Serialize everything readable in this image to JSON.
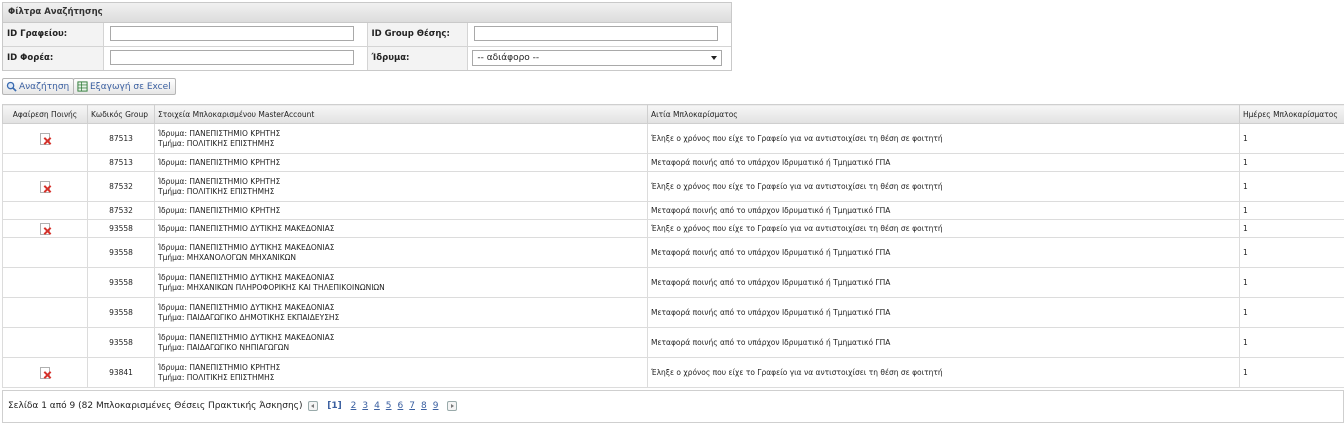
{
  "filter": {
    "title": "Φίλτρα Αναζήτησης",
    "office_id_label": "ID Γραφείου:",
    "office_id_value": "",
    "group_id_label": "ID Group Θέσης:",
    "group_id_value": "",
    "provider_id_label": "ID Φορέα:",
    "provider_id_value": "",
    "institution_label": "Ίδρυμα:",
    "institution_value": "-- αδιάφορο --"
  },
  "toolbar": {
    "search_label": "Αναζήτηση",
    "export_label": "Εξαγωγή σε Excel"
  },
  "grid": {
    "columns": [
      "Αφαίρεση Ποινής",
      "Κωδικός Group",
      "Στοιχεία Μπλοκαρισμένου MasterAccount",
      "Αιτία Μπλοκαρίσματος",
      "Ημέρες Μπλοκαρίσματος"
    ],
    "rows": [
      {
        "remove": true,
        "group": "87513",
        "line1": "Ίδρυμα: ΠΑΝΕΠΙΣΤΗΜΙΟ ΚΡΗΤΗΣ",
        "line2": "Τμήμα: ΠΟΛΙΤΙΚΗΣ ΕΠΙΣΤΗΜΗΣ",
        "reason": "Έληξε ο χρόνος που είχε το Γραφείο για να αντιστοιχίσει τη θέση σε φοιτητή",
        "days": "1"
      },
      {
        "remove": false,
        "group": "87513",
        "line1": "Ίδρυμα: ΠΑΝΕΠΙΣΤΗΜΙΟ ΚΡΗΤΗΣ",
        "line2": "",
        "reason": "Μεταφορά ποινής από το υπάρχον Ιδρυματικό ή Τμηματικό ΓΠΑ",
        "days": "1"
      },
      {
        "remove": true,
        "group": "87532",
        "line1": "Ίδρυμα: ΠΑΝΕΠΙΣΤΗΜΙΟ ΚΡΗΤΗΣ",
        "line2": "Τμήμα: ΠΟΛΙΤΙΚΗΣ ΕΠΙΣΤΗΜΗΣ",
        "reason": "Έληξε ο χρόνος που είχε το Γραφείο για να αντιστοιχίσει τη θέση σε φοιτητή",
        "days": "1"
      },
      {
        "remove": false,
        "group": "87532",
        "line1": "Ίδρυμα: ΠΑΝΕΠΙΣΤΗΜΙΟ ΚΡΗΤΗΣ",
        "line2": "",
        "reason": "Μεταφορά ποινής από το υπάρχον Ιδρυματικό ή Τμηματικό ΓΠΑ",
        "days": "1"
      },
      {
        "remove": true,
        "group": "93558",
        "line1": "Ίδρυμα: ΠΑΝΕΠΙΣΤΗΜΙΟ ΔΥΤΙΚΗΣ ΜΑΚΕΔΟΝΙΑΣ",
        "line2": "",
        "reason": "Έληξε ο χρόνος που είχε το Γραφείο για να αντιστοιχίσει τη θέση σε φοιτητή",
        "days": "1"
      },
      {
        "remove": false,
        "group": "93558",
        "line1": "Ίδρυμα: ΠΑΝΕΠΙΣΤΗΜΙΟ ΔΥΤΙΚΗΣ ΜΑΚΕΔΟΝΙΑΣ",
        "line2": "Τμήμα: ΜΗΧΑΝΟΛΟΓΩΝ ΜΗΧΑΝΙΚΩΝ",
        "reason": "Μεταφορά ποινής από το υπάρχον Ιδρυματικό ή Τμηματικό ΓΠΑ",
        "days": "1"
      },
      {
        "remove": false,
        "group": "93558",
        "line1": "Ίδρυμα: ΠΑΝΕΠΙΣΤΗΜΙΟ ΔΥΤΙΚΗΣ ΜΑΚΕΔΟΝΙΑΣ",
        "line2": "Τμήμα: ΜΗΧΑΝΙΚΩΝ ΠΛΗΡΟΦΟΡΙΚΗΣ ΚΑΙ ΤΗΛΕΠΙΚΟΙΝΩΝΙΩΝ",
        "reason": "Μεταφορά ποινής από το υπάρχον Ιδρυματικό ή Τμηματικό ΓΠΑ",
        "days": "1"
      },
      {
        "remove": false,
        "group": "93558",
        "line1": "Ίδρυμα: ΠΑΝΕΠΙΣΤΗΜΙΟ ΔΥΤΙΚΗΣ ΜΑΚΕΔΟΝΙΑΣ",
        "line2": "Τμήμα: ΠΑΙΔΑΓΩΓΙΚΟ ΔΗΜΟΤΙΚΗΣ ΕΚΠΑΙΔΕΥΣΗΣ",
        "reason": "Μεταφορά ποινής από το υπάρχον Ιδρυματικό ή Τμηματικό ΓΠΑ",
        "days": "1"
      },
      {
        "remove": false,
        "group": "93558",
        "line1": "Ίδρυμα: ΠΑΝΕΠΙΣΤΗΜΙΟ ΔΥΤΙΚΗΣ ΜΑΚΕΔΟΝΙΑΣ",
        "line2": "Τμήμα: ΠΑΙΔΑΓΩΓΙΚΟ ΝΗΠΙΑΓΩΓΩΝ",
        "reason": "Μεταφορά ποινής από το υπάρχον Ιδρυματικό ή Τμηματικό ΓΠΑ",
        "days": "1"
      },
      {
        "remove": true,
        "group": "93841",
        "line1": "Ίδρυμα: ΠΑΝΕΠΙΣΤΗΜΙΟ ΚΡΗΤΗΣ",
        "line2": "Τμήμα: ΠΟΛΙΤΙΚΗΣ ΕΠΙΣΤΗΜΗΣ",
        "reason": "Έληξε ο χρόνος που είχε το Γραφείο για να αντιστοιχίσει τη θέση σε φοιτητή",
        "days": "1"
      }
    ]
  },
  "pager": {
    "summary": "Σελίδα 1 από 9 (82 Μπλοκαρισμένες Θέσεις Πρακτικής Άσκησης)",
    "current": "[1]",
    "pages": [
      "2",
      "3",
      "4",
      "5",
      "6",
      "7",
      "8",
      "9"
    ]
  },
  "colors": {
    "link": "#3a5fa0",
    "delete_icon": "#d6322b"
  }
}
